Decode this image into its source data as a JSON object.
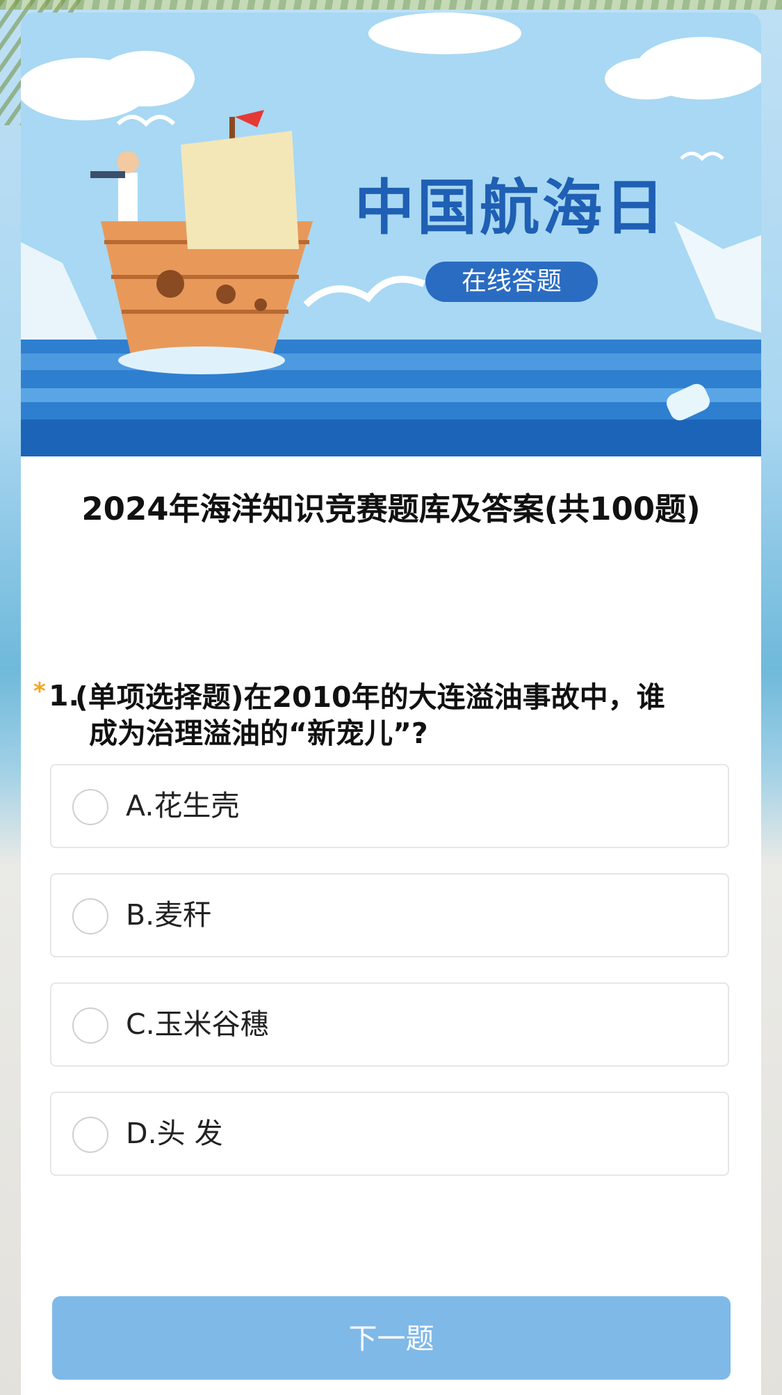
{
  "banner": {
    "title": "中国航海日",
    "badge": "在线答题"
  },
  "page": {
    "title": "2024年海洋知识竞赛题库及答案(共100题)"
  },
  "question": {
    "required_mark": "*",
    "number": "1.",
    "text_line1": "(单项选择题)在2010年的大连溢油事故中，谁",
    "text_line2": "成为治理溢油的“新宠儿”?",
    "options": [
      {
        "label": "A.花生壳"
      },
      {
        "label": "B.麦秆"
      },
      {
        "label": "C.玉米谷穗"
      },
      {
        "label": "D.头 发"
      }
    ]
  },
  "footer": {
    "next_label": "下一题"
  },
  "colors": {
    "accent": "#1f5fb4",
    "button": "#7fb9e8",
    "required": "#f5a623"
  }
}
